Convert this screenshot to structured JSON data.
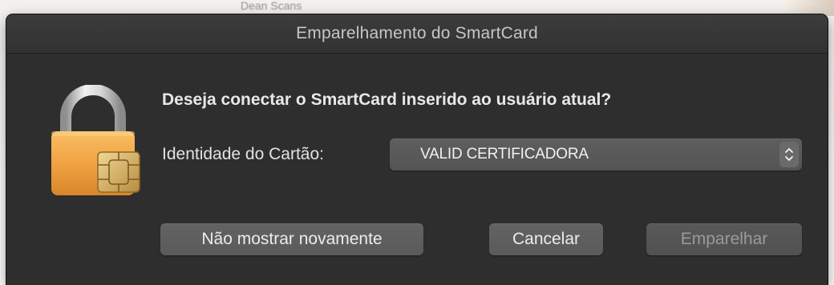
{
  "background": {
    "partial_text": "Dean Scans"
  },
  "window": {
    "title": "Emparelhamento do SmartCard"
  },
  "dialog": {
    "icon": "smartcard-lock-icon",
    "question": "Deseja conectar o SmartCard inserido ao usuário atual?",
    "identity_label": "Identidade do Cartão:",
    "identity_select": {
      "selected_value": "VALID CERTIFICADORA",
      "icon": "up-down-chevron-icon"
    }
  },
  "buttons": {
    "dont_show_again": "Não mostrar novamente",
    "cancel": "Cancelar",
    "pair": "Emparelhar",
    "pair_enabled": false
  },
  "colors": {
    "window_bg": "#2e2e2e",
    "title_text": "#c6c6c6",
    "lock_shackle": "#cfcfcf",
    "lock_body": "#f3a64a",
    "chip": "#d8b46a"
  }
}
